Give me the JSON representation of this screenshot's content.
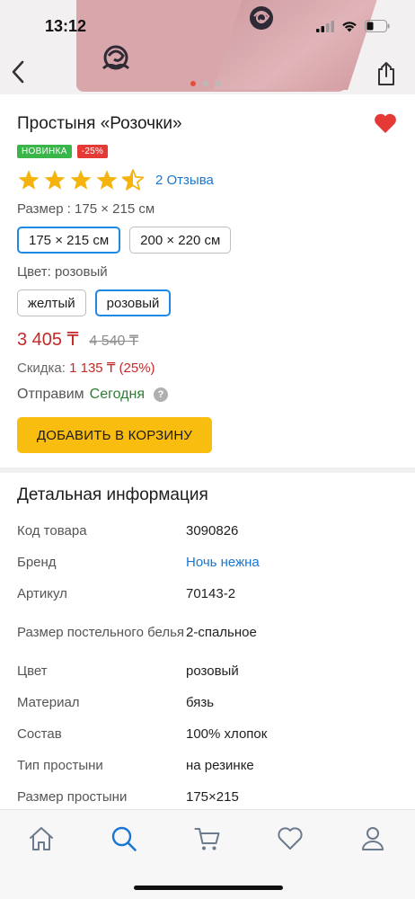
{
  "status_bar": {
    "time": "13:12"
  },
  "gallery": {
    "image_count": 3,
    "active_index": 0
  },
  "product": {
    "title": "Простыня «Розочки»",
    "badges": {
      "new": "НОВИНКА",
      "discount": "-25%"
    },
    "rating": 4.5,
    "reviews_link": "2 Отзыва",
    "size_label": "Размер : 175 × 215 см",
    "sizes": [
      "175 × 215 см",
      "200 × 220 см"
    ],
    "selected_size": "175 × 215 см",
    "color_label": "Цвет: розовый",
    "colors": [
      "желтый",
      "розовый"
    ],
    "selected_color": "розовый",
    "price": "3 405 ₸",
    "old_price": "4 540 ₸",
    "discount_label": "Скидка:",
    "discount_value": "1 135 ₸ (25%)",
    "ship_label": "Отправим",
    "ship_when": "Сегодня",
    "add_to_cart": "ДОБАВИТЬ В КОРЗИНУ"
  },
  "details": {
    "title": "Детальная информация",
    "rows": [
      {
        "key": "Код товара",
        "value": "3090826"
      },
      {
        "key": "Бренд",
        "value": "Ночь нежна"
      },
      {
        "key": "Артикул",
        "value": "70143-2"
      },
      {
        "key": "Размер постельного белья",
        "value": "2-спальное"
      },
      {
        "key": "Цвет",
        "value": "розовый"
      },
      {
        "key": "Материал",
        "value": "бязь"
      },
      {
        "key": "Состав",
        "value": "100% хлопок"
      },
      {
        "key": "Тип простыни",
        "value": "на резинке"
      },
      {
        "key": "Размер простыни",
        "value": "175×215"
      }
    ]
  },
  "tabbar": {
    "items": [
      "home-icon",
      "search-icon",
      "cart-icon",
      "heart-icon",
      "profile-icon"
    ],
    "active": "search-icon"
  },
  "colors": {
    "accent_blue": "#1976d2",
    "price_red": "#c62828",
    "cta_yellow": "#f9bd0f",
    "heart_red": "#e53935",
    "badge_green": "#3ab54a"
  }
}
